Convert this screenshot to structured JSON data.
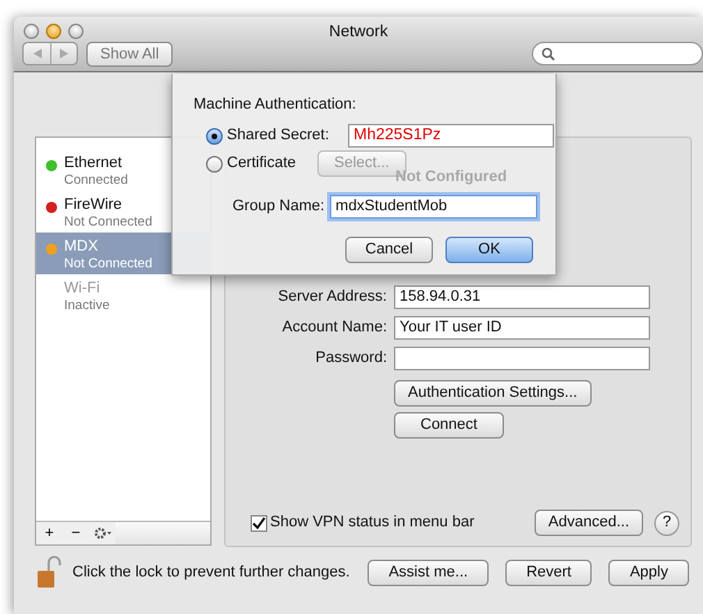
{
  "window": {
    "title": "Network"
  },
  "toolbar": {
    "show_all": "Show All"
  },
  "services": [
    {
      "name": "Ethernet",
      "status": "Connected",
      "color": "#3fbf2a",
      "selected": false,
      "disabled": false
    },
    {
      "name": "FireWire",
      "status": "Not Connected",
      "color": "#d42020",
      "selected": false,
      "disabled": false
    },
    {
      "name": "MDX",
      "status": "Not Connected",
      "color": "#f0a020",
      "selected": true,
      "disabled": false
    },
    {
      "name": "Wi-Fi",
      "status": "Inactive",
      "selected": false,
      "disabled": true
    }
  ],
  "sidebar_tools": [
    "+",
    "−"
  ],
  "detail": {
    "status_behind": "Not Configured",
    "fields": [
      {
        "label": "Server Address:",
        "value": "158.94.0.31"
      },
      {
        "label": "Account Name:",
        "value": "Your IT user ID"
      },
      {
        "label": "Password:"
      }
    ],
    "buttons": [
      "Authentication Settings...",
      "Connect"
    ],
    "show_status": {
      "label": "Show VPN status in menu bar",
      "checked": true
    },
    "advanced": "Advanced...",
    "help": "?"
  },
  "sheet": {
    "heading": "Machine Authentication:",
    "options": [
      {
        "kind": "field",
        "label": "Shared Secret:",
        "selected": true,
        "value": "Mh225S1Pz"
      },
      {
        "kind": "button",
        "label": "Certificate",
        "selected": false,
        "button": "Select...",
        "disabled": true
      }
    ],
    "group_label": "Group Name:",
    "group_value": "mdxStudentMob",
    "buttons": [
      {
        "label": "Cancel",
        "default": false
      },
      {
        "label": "OK",
        "default": true
      }
    ]
  },
  "footer": {
    "lock_text": "Click the lock to prevent further changes.",
    "buttons": [
      "Assist me...",
      "Revert",
      "Apply"
    ]
  }
}
